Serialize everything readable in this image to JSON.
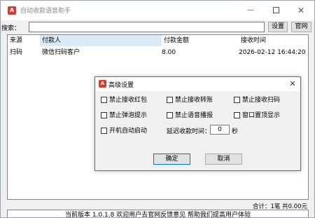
{
  "window": {
    "title": "自动收款语音助手",
    "icon_glyph": "A",
    "accent_color": "#d93a2b"
  },
  "search": {
    "label": "搜索：",
    "value": "",
    "settings_label": "设置",
    "website_label": "官网"
  },
  "table": {
    "columns": [
      "来源",
      "付款人",
      "付款金额",
      "接收时间"
    ],
    "rows": [
      {
        "source": "扫码",
        "payer": "微信扫码客户",
        "amount": "8.00",
        "time": "2026-02-12 16:44:20"
      }
    ]
  },
  "summary": "合计：1笔 共0.00元",
  "status": "当前版本 1.0.1.8 欢迎用户去官网反馈意见 帮助我们提高用户体验",
  "dialog": {
    "title": "高级设置",
    "icon_glyph": "A",
    "options": [
      {
        "label": "禁止接收红包",
        "checked": false
      },
      {
        "label": "禁止接收转账",
        "checked": false
      },
      {
        "label": "禁止接收扫码",
        "checked": false
      },
      {
        "label": "禁止弹泡提示",
        "checked": false
      },
      {
        "label": "禁止语音播报",
        "checked": false
      },
      {
        "label": "窗口置顶显示",
        "checked": false
      },
      {
        "label": "开机自动启动",
        "checked": false
      }
    ],
    "delay_label": "延迟收款时间：",
    "delay_value": "0",
    "delay_unit": "秒",
    "ok_label": "确定",
    "cancel_label": "取消"
  }
}
